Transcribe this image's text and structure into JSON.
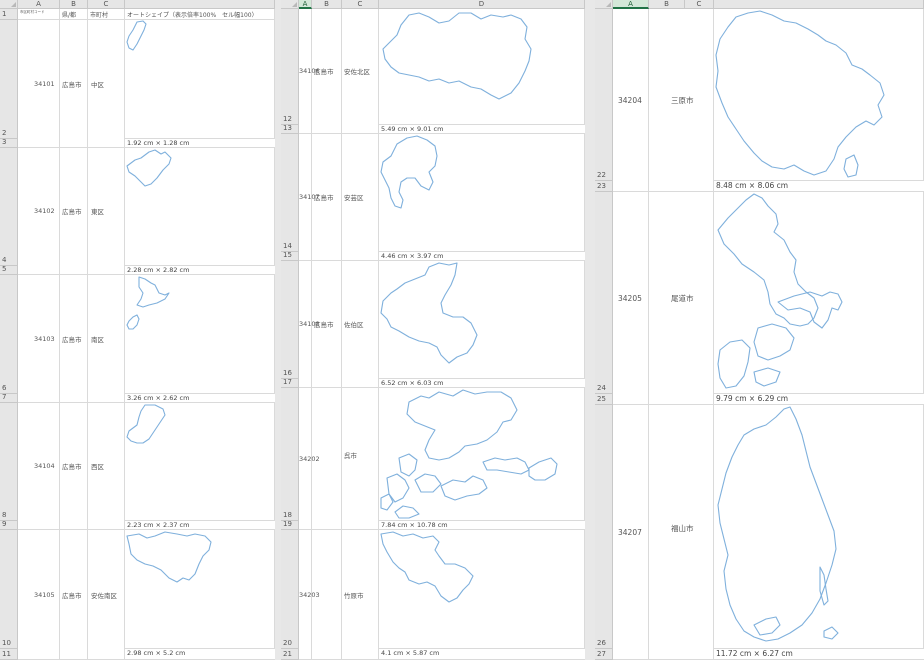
{
  "panel1": {
    "columns": [
      "A",
      "B",
      "C"
    ],
    "header_row": {
      "row_no": "1",
      "a": "市区町村コード",
      "b": "県/都",
      "c": "市町村",
      "d": "オートシェイプ（表示倍率100%　セル幅100）"
    },
    "records": [
      {
        "label_row": "2",
        "dim_row": "3",
        "code": "34101",
        "pref": "広島市",
        "ward": "中区",
        "dims": "1.92 cm × 1.28 cm"
      },
      {
        "label_row": "4",
        "dim_row": "5",
        "code": "34102",
        "pref": "広島市",
        "ward": "東区",
        "dims": "2.28 cm × 2.82 cm"
      },
      {
        "label_row": "6",
        "dim_row": "7",
        "code": "34103",
        "pref": "広島市",
        "ward": "南区",
        "dims": "3.26 cm × 2.62 cm"
      },
      {
        "label_row": "8",
        "dim_row": "9",
        "code": "34104",
        "pref": "広島市",
        "ward": "西区",
        "dims": "2.23 cm × 2.37 cm"
      },
      {
        "label_row": "10",
        "dim_row": "11",
        "code": "34105",
        "pref": "広島市",
        "ward": "安佐南区",
        "dims": "2.98 cm × 5.2 cm"
      }
    ]
  },
  "panel2": {
    "columns": [
      "A",
      "B",
      "C",
      "D"
    ],
    "records": [
      {
        "label_row": "12",
        "dim_row": "13",
        "code": "34106",
        "pref": "広島市",
        "ward": "安佐北区",
        "dims": "5.49 cm × 9.01 cm"
      },
      {
        "label_row": "14",
        "dim_row": "15",
        "code": "34107",
        "pref": "広島市",
        "ward": "安芸区",
        "dims": "4.46 cm × 3.97 cm"
      },
      {
        "label_row": "16",
        "dim_row": "17",
        "code": "34108",
        "pref": "広島市",
        "ward": "佐伯区",
        "dims": "6.52 cm × 6.03 cm"
      },
      {
        "label_row": "18",
        "dim_row": "19",
        "code": "34202",
        "pref": "",
        "ward": "呉市",
        "dims": "7.84 cm × 10.78 cm"
      },
      {
        "label_row": "20",
        "dim_row": "21",
        "code": "34203",
        "pref": "",
        "ward": "竹原市",
        "dims": "4.1 cm × 5.87 cm"
      }
    ]
  },
  "panel3": {
    "columns": [
      "A",
      "B",
      "C"
    ],
    "records": [
      {
        "label_row": "22",
        "dim_row": "23",
        "code": "34204",
        "pref": "",
        "ward": "三原市",
        "dims": "8.48 cm × 8.06 cm"
      },
      {
        "label_row": "24",
        "dim_row": "25",
        "code": "34205",
        "pref": "",
        "ward": "尾道市",
        "dims": "9.79 cm × 6.29 cm"
      },
      {
        "label_row": "26",
        "dim_row": "27",
        "code": "34207",
        "pref": "",
        "ward": "福山市",
        "dims": "11.72 cm × 6.27 cm"
      }
    ]
  },
  "colors": {
    "shape_outline": "#7fb0dc",
    "header_bg": "#e6e6e6",
    "selected_header": "#217346"
  }
}
